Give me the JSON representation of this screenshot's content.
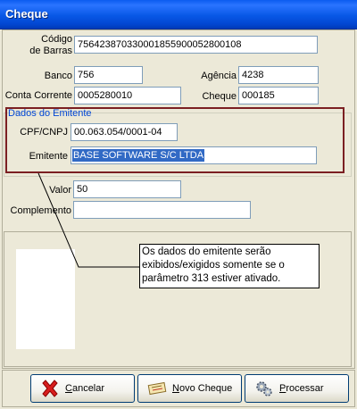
{
  "window": {
    "title": "Cheque"
  },
  "form": {
    "codigo_barras_label_1": "Código",
    "codigo_barras_label_2": "de Barras",
    "codigo_barras_value": "75642387033000185590005280010​8",
    "banco_label": "Banco",
    "banco_value": "756",
    "agencia_label": "Agência",
    "agencia_value": "4238",
    "conta_label": "Conta Corrente",
    "conta_value": "0005280010",
    "cheque_label": "Cheque",
    "cheque_value": "000185",
    "valor_label": "Valor",
    "valor_value": "50",
    "complemento_label": "Complemento",
    "complemento_value": ""
  },
  "emitente": {
    "group_title": "Dados do Emitente",
    "cpf_label": "CPF/CNPJ",
    "cpf_value": "00.063.054/0001-04",
    "emitente_label": "Emitente",
    "emitente_value": "BASE SOFTWARE S/C LTDA"
  },
  "annotation": {
    "line1": "Os dados do emitente serão",
    "line2": "exibidos/exigidos somente se o",
    "line3": "parâmetro 313 estiver ativado."
  },
  "buttons": {
    "cancelar_first": "C",
    "cancelar_rest": "ancelar",
    "novo_first": "N",
    "novo_rest": "ovo Cheque",
    "processar_first": "P",
    "processar_rest": "rocessar"
  },
  "icons": {
    "cancel": "red-x-icon",
    "new_cheque": "cheque-icon",
    "process": "gears-icon"
  },
  "colors": {
    "title_bar": "#0858e6",
    "highlight_border": "#7b1f22",
    "group_title": "#0046d5",
    "selection": "#316ac5"
  }
}
